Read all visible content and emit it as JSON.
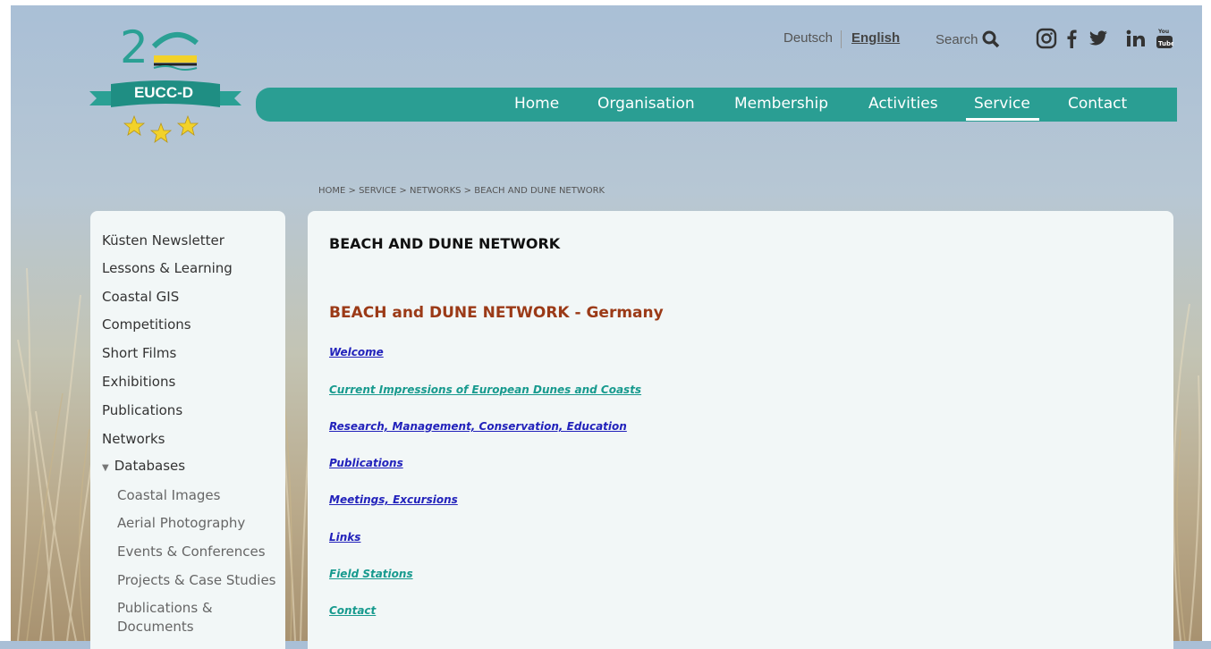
{
  "logo": {
    "number": "2",
    "text": "EUCC-D"
  },
  "utility": {
    "lang_de": "Deutsch",
    "lang_en": "English",
    "search_label": "Search",
    "social": [
      "instagram-icon",
      "facebook-icon",
      "twitter-icon",
      "linkedin-icon",
      "youtube-icon"
    ]
  },
  "nav": {
    "items": [
      {
        "label": "Home"
      },
      {
        "label": "Organisation"
      },
      {
        "label": "Membership"
      },
      {
        "label": "Activities"
      },
      {
        "label": "Service",
        "active": true
      },
      {
        "label": "Contact"
      }
    ],
    "color": "#2a9e93"
  },
  "breadcrumb": "HOME > SERVICE > NETWORKS > BEACH AND DUNE NETWORK",
  "sidebar": {
    "items": [
      {
        "label": "Küsten Newsletter"
      },
      {
        "label": "Lessons & Learning"
      },
      {
        "label": "Coastal GIS"
      },
      {
        "label": "Competitions"
      },
      {
        "label": "Short Films"
      },
      {
        "label": "Exhibitions"
      },
      {
        "label": "Publications"
      },
      {
        "label": "Networks"
      },
      {
        "label": "Databases",
        "expanded": true
      }
    ],
    "sub_items": [
      {
        "label": "Coastal Images"
      },
      {
        "label": "Aerial Photography"
      },
      {
        "label": "Events & Conferences"
      },
      {
        "label": "Projects & Case Studies"
      },
      {
        "label": "Publications &"
      },
      {
        "label": "Documents"
      }
    ]
  },
  "content": {
    "title": "BEACH AND DUNE NETWORK",
    "subtitle": "BEACH and DUNE NETWORK - Germany",
    "links": [
      {
        "label": "Welcome",
        "color": "#2222bb"
      },
      {
        "label": "Current Impressions of European Dunes and Coasts",
        "color": "#179a8e"
      },
      {
        "label": "Research, Management, Conservation, Education",
        "color": "#2222bb"
      },
      {
        "label": "Publications",
        "color": "#2222bb"
      },
      {
        "label": "Meetings, Excursions",
        "color": "#2222bb"
      },
      {
        "label": "Links",
        "color": "#2222bb"
      },
      {
        "label": "Field Stations",
        "color": "#179a8e"
      },
      {
        "label": "Contact",
        "color": "#179a8e"
      }
    ]
  }
}
